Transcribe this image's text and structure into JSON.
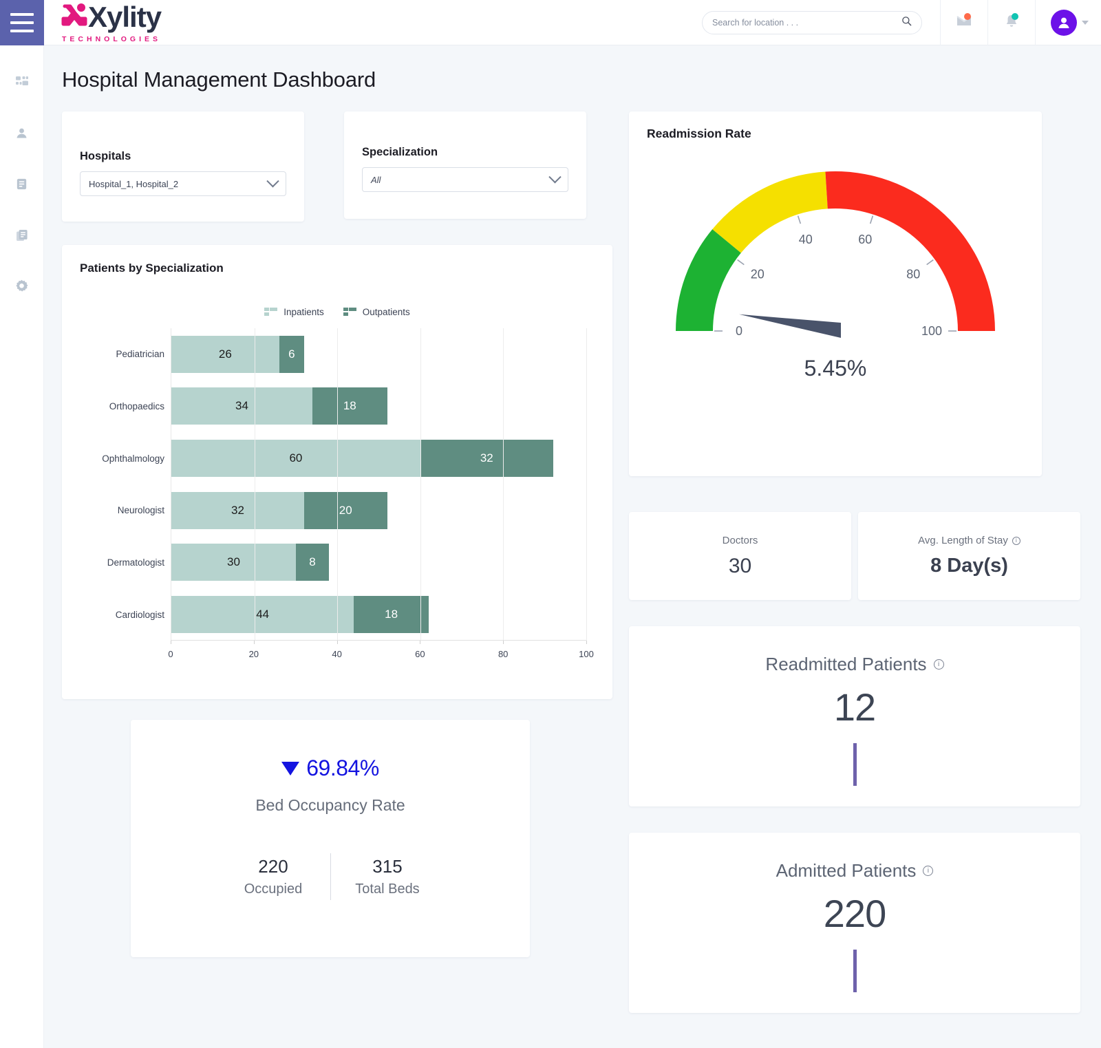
{
  "brand": {
    "name": "Xylity",
    "tagline": "TECHNOLOGIES",
    "logo_pink": "#e2197f",
    "logo_dark": "#2b3247"
  },
  "topbar": {
    "menu_icon": "hamburger-icon",
    "search": {
      "placeholder": "Search for location . . .",
      "value": "",
      "icon": "search-icon"
    },
    "mail_icon": "mail-icon",
    "mail_badge": true,
    "bell_icon": "bell-icon",
    "bell_badge": true,
    "avatar_icon": "user-avatar-icon",
    "avatar_color": "#6c11e8",
    "caret_icon": "chevron-down-icon"
  },
  "sidebar": {
    "items": [
      {
        "name": "dashboard",
        "icon": "dashboard-grid-icon"
      },
      {
        "name": "users",
        "icon": "person-icon"
      },
      {
        "name": "reports",
        "icon": "document-icon"
      },
      {
        "name": "documents",
        "icon": "documents-copy-icon"
      },
      {
        "name": "settings",
        "icon": "gear-icon"
      }
    ]
  },
  "page": {
    "title": "Hospital Management Dashboard"
  },
  "filters": {
    "hospitals": {
      "label": "Hospitals",
      "value": "Hospital_1, Hospital_2",
      "caret": "chevron-down-icon"
    },
    "specialization": {
      "label": "Specialization",
      "value": "All",
      "caret": "chevron-down-icon"
    }
  },
  "bed_occupancy": {
    "trend_icon": "triangle-down-icon",
    "percent": "69.84%",
    "title": "Bed Occupancy Rate",
    "occupied_value": "220",
    "occupied_label": "Occupied",
    "total_value": "315",
    "total_label": "Total Beds",
    "accent_color": "#1414e0"
  },
  "readmission": {
    "title": "Readmission Rate",
    "value_label": "5.45%"
  },
  "mini_kpis": [
    {
      "label": "Doctors",
      "value": "30",
      "has_info": false
    },
    {
      "label": "Avg. Length of Stay",
      "value": "8 Day(s)",
      "has_info": true,
      "info_icon": "info-circle-icon"
    }
  ],
  "big_kpis": [
    {
      "title": "Readmitted Patients",
      "value": "12",
      "info_icon": "info-circle-icon",
      "bar_color": "#6e62ab"
    },
    {
      "title": "Admitted Patients",
      "value": "220",
      "info_icon": "info-circle-icon",
      "bar_color": "#6e62ab"
    }
  ],
  "chart_data": [
    {
      "type": "bar",
      "orientation": "horizontal",
      "stacked": true,
      "title": "Patients by Specialization",
      "xlabel": "",
      "ylabel": "",
      "xlim": [
        0,
        100
      ],
      "xticks": [
        0,
        20,
        40,
        60,
        80,
        100
      ],
      "grid": true,
      "legend_position": "top-center",
      "categories": [
        "Pediatrician",
        "Orthopaedics",
        "Ophthalmology",
        "Neurologist",
        "Dermatologist",
        "Cardiologist"
      ],
      "series": [
        {
          "name": "Inpatients",
          "color": "#b6d3ce",
          "values": [
            26,
            34,
            60,
            32,
            30,
            44
          ]
        },
        {
          "name": "Outpatients",
          "color": "#5f8d81",
          "values": [
            6,
            18,
            32,
            20,
            8,
            18
          ]
        }
      ]
    },
    {
      "type": "gauge",
      "title": "Readmission Rate",
      "value": 5.45,
      "value_label": "5.45%",
      "min": 0,
      "max": 100,
      "ticks": [
        0,
        20,
        40,
        60,
        80,
        100
      ],
      "bands": [
        {
          "from": 0,
          "to": 22,
          "color": "#1db233"
        },
        {
          "from": 22,
          "to": 48,
          "color": "#f5e000"
        },
        {
          "from": 48,
          "to": 100,
          "color": "#fb2b1e"
        }
      ],
      "needle_color": "#49536a"
    }
  ]
}
